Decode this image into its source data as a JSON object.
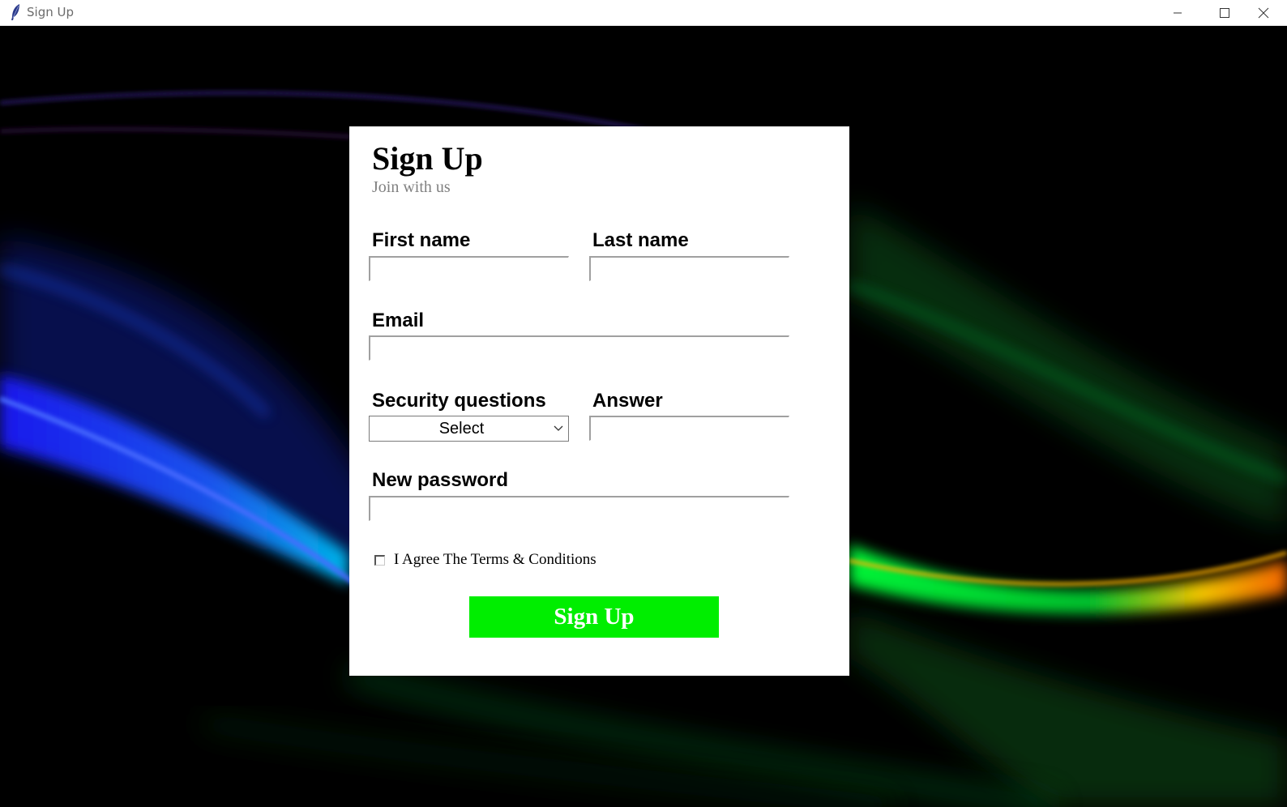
{
  "window": {
    "title": "Sign Up",
    "controls": [
      "minimize-icon",
      "maximize-icon",
      "close-icon"
    ],
    "app_icon": "feather-icon"
  },
  "form": {
    "title": "Sign Up",
    "subtitle": "Join with us",
    "first_name": {
      "label": "First name",
      "value": ""
    },
    "last_name": {
      "label": "Last name",
      "value": ""
    },
    "email": {
      "label": "Email",
      "value": ""
    },
    "security_question": {
      "label": "Security questions",
      "selected": "Select"
    },
    "answer": {
      "label": "Answer",
      "value": ""
    },
    "new_password": {
      "label": "New password",
      "value": ""
    },
    "terms_checkbox": {
      "label": "I Agree The Terms & Conditions",
      "checked": false
    },
    "submit_label": "Sign Up"
  },
  "colors": {
    "card_background": "#ffffff",
    "button_background": "#00ee00",
    "button_text": "#ffffff",
    "subtitle_text": "#808080",
    "backdrop": "#000000"
  }
}
